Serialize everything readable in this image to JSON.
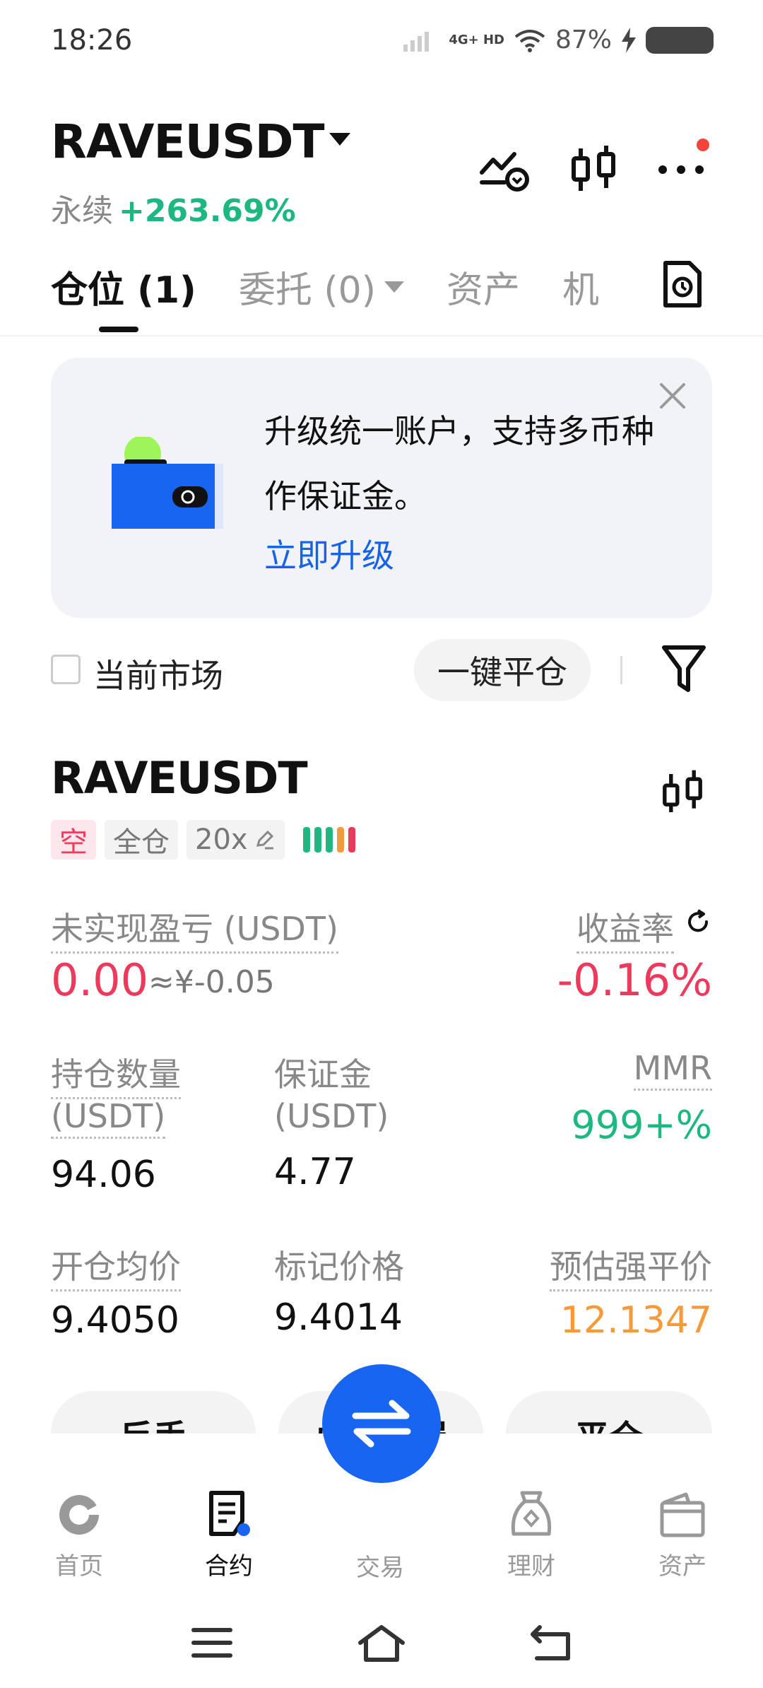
{
  "status_bar": {
    "time": "18:26",
    "network": "4G+ HD",
    "battery_pct": "87%"
  },
  "header": {
    "symbol": "RAVEUSDT",
    "type": "永续",
    "change": "+263.69%"
  },
  "tabs": [
    {
      "label": "仓位 (1)"
    },
    {
      "label": "委托 (0)"
    },
    {
      "label": "资产"
    },
    {
      "label": "机"
    }
  ],
  "banner": {
    "text": "升级统一账户，支持多币种作保证金。",
    "link": "立即升级"
  },
  "filter": {
    "current_market": "当前市场",
    "one_click_close": "一键平仓"
  },
  "position": {
    "symbol": "RAVEUSDT",
    "tags": {
      "side": "空",
      "margin_mode": "全仓",
      "leverage": "20x"
    },
    "risk_bar_colors": [
      "#1db880",
      "#1db880",
      "#1db880",
      "#f59a3b",
      "#ec3a5c"
    ],
    "unrealized_pnl_label": "未实现盈亏 (USDT)",
    "unrealized_pnl": "0.00",
    "unrealized_pnl_cny": "≈¥-0.05",
    "ror_label": "收益率",
    "ror": "-0.16%",
    "size_label_1": "持仓数量",
    "size_label_2": "(USDT)",
    "size": "94.06",
    "margin_label_1": "保证金",
    "margin_label_2": "(USDT)",
    "margin": "4.77",
    "mmr_label": "MMR",
    "mmr": "999+%",
    "entry_label": "开仓均价",
    "entry": "9.4050",
    "mark_label": "标记价格",
    "mark": "9.4014",
    "liq_label": "预估强平价",
    "liq": "12.1347"
  },
  "actions": {
    "reverse": "反手",
    "tpsl": "止盈止损",
    "close": "平仓"
  },
  "bottom_nav": [
    {
      "label": "首页",
      "icon": "home-icon"
    },
    {
      "label": "合约",
      "icon": "contract-icon"
    },
    {
      "label": "交易",
      "icon": "trade-icon"
    },
    {
      "label": "理财",
      "icon": "earn-icon"
    },
    {
      "label": "资产",
      "icon": "wallet-icon"
    }
  ],
  "colors": {
    "green": "#1db880",
    "red": "#ec3a5c",
    "orange": "#f59a3b",
    "blue": "#1865f2"
  }
}
